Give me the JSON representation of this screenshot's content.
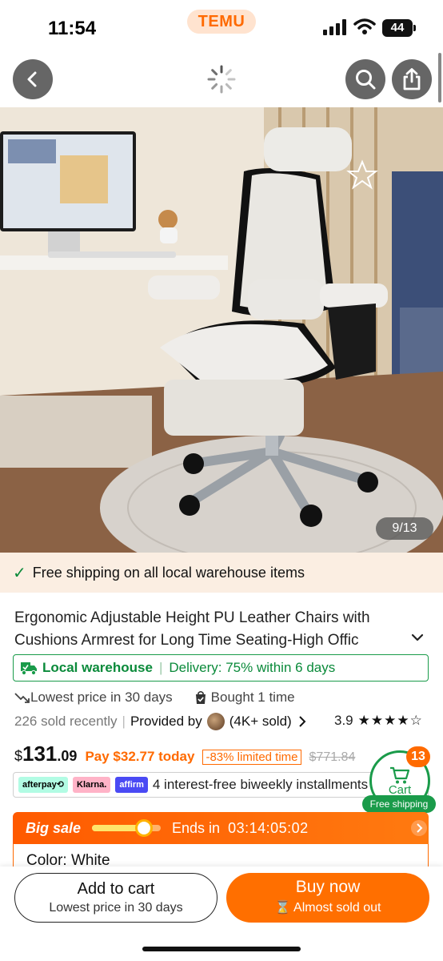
{
  "status_bar": {
    "time": "11:54",
    "brand": "TEMU",
    "battery": "44"
  },
  "header": {
    "back_icon": "chevron-left-icon",
    "loading_icon": "spinner-icon",
    "search_icon": "search-icon",
    "share_icon": "share-icon"
  },
  "gallery": {
    "counter": "9/13"
  },
  "shipping_banner": {
    "text": "Free shipping on all local warehouse items"
  },
  "product": {
    "title_line1": "Ergonomic Adjustable Height PU Leather Chairs with",
    "title_line2": "Cushions Armrest for Long Time Seating-High Offic"
  },
  "warehouse": {
    "label": "Local warehouse",
    "delivery": "Delivery: 75% within 6 days"
  },
  "meta": {
    "lowest_price": "Lowest price in 30 days",
    "bought": "Bought 1 time",
    "sold_recently": "226 sold recently",
    "provided_by": "Provided by",
    "seller_sold": "(4K+ sold)",
    "rating": "3.9",
    "stars": "★★★★☆"
  },
  "price": {
    "currency": "$",
    "integer": "131",
    "decimal": ".09",
    "pay_today": "Pay $32.77 today",
    "discount": "-83% limited time",
    "original": "$771.84"
  },
  "installments": {
    "providers": [
      "afterpay⟲",
      "Klarna.",
      "affirm"
    ],
    "text": "4 interest-free biweekly installments"
  },
  "cart": {
    "label": "Cart",
    "count": "13",
    "free_shipping": "Free shipping"
  },
  "big_sale": {
    "label": "Big sale",
    "progress": 0.75,
    "ends_label": "Ends in",
    "countdown": "03:14:05:02"
  },
  "color": {
    "label": "Color: White"
  },
  "actions": {
    "add_to_cart": "Add to cart",
    "add_to_cart_sub": "Lowest price in 30 days",
    "buy_now": "Buy now",
    "buy_now_sub": "Almost sold out"
  },
  "colors": {
    "accent": "#ff6a00",
    "green": "#1a9b4a"
  }
}
